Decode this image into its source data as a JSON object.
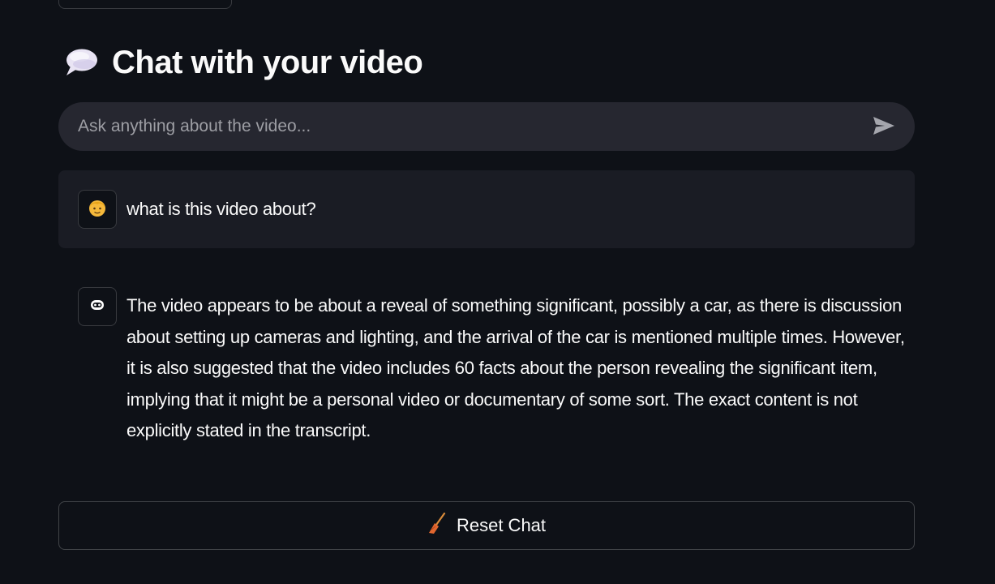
{
  "header": {
    "title": "Chat with your video",
    "title_icon": "speech-balloon-icon"
  },
  "chat_input": {
    "placeholder": "Ask anything about the video...",
    "value": "",
    "send_icon": "send-arrow-icon"
  },
  "messages": [
    {
      "role": "user",
      "avatar_icon": "user-face-icon",
      "text": "what is this video about?"
    },
    {
      "role": "assistant",
      "avatar_icon": "robot-face-icon",
      "text": "The video appears to be about a reveal of something significant, possibly a car, as there is discussion about setting up cameras and lighting, and the arrival of the car is mentioned multiple times. However, it is also suggested that the video includes 60 facts about the person revealing the significant item, implying that it might be a personal video or documentary of some sort. The exact content is not explicitly stated in the transcript."
    }
  ],
  "reset_button": {
    "label": "Reset Chat",
    "icon": "broom-icon"
  },
  "colors": {
    "background": "#0e1117",
    "input_background": "#262730",
    "user_message_background": "#1a1c24",
    "text": "#fafafa",
    "placeholder": "#9d9ea4"
  }
}
